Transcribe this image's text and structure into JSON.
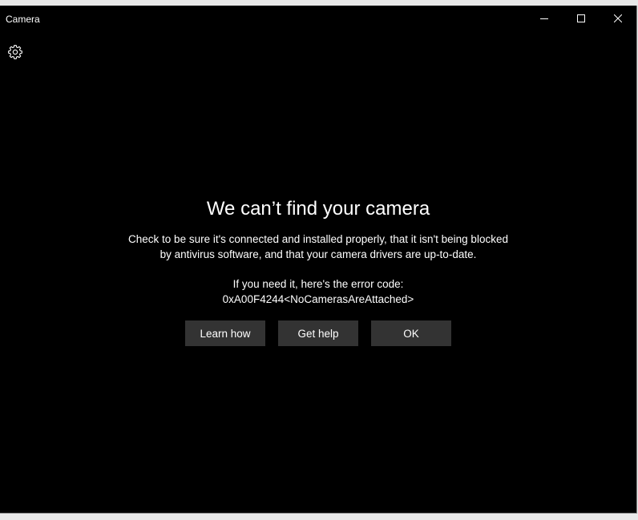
{
  "window": {
    "title": "Camera"
  },
  "dialog": {
    "heading": "We can’t find your camera",
    "message_line1": "Check to be sure it's connected and installed properly, that it isn't being blocked",
    "message_line2": "by antivirus software, and that your camera drivers are up-to-date.",
    "error_label": "If you need it, here's the error code:",
    "error_code": "0xA00F4244<NoCamerasAreAttached>",
    "buttons": {
      "learn": "Learn how",
      "help": "Get help",
      "ok": "OK"
    }
  }
}
